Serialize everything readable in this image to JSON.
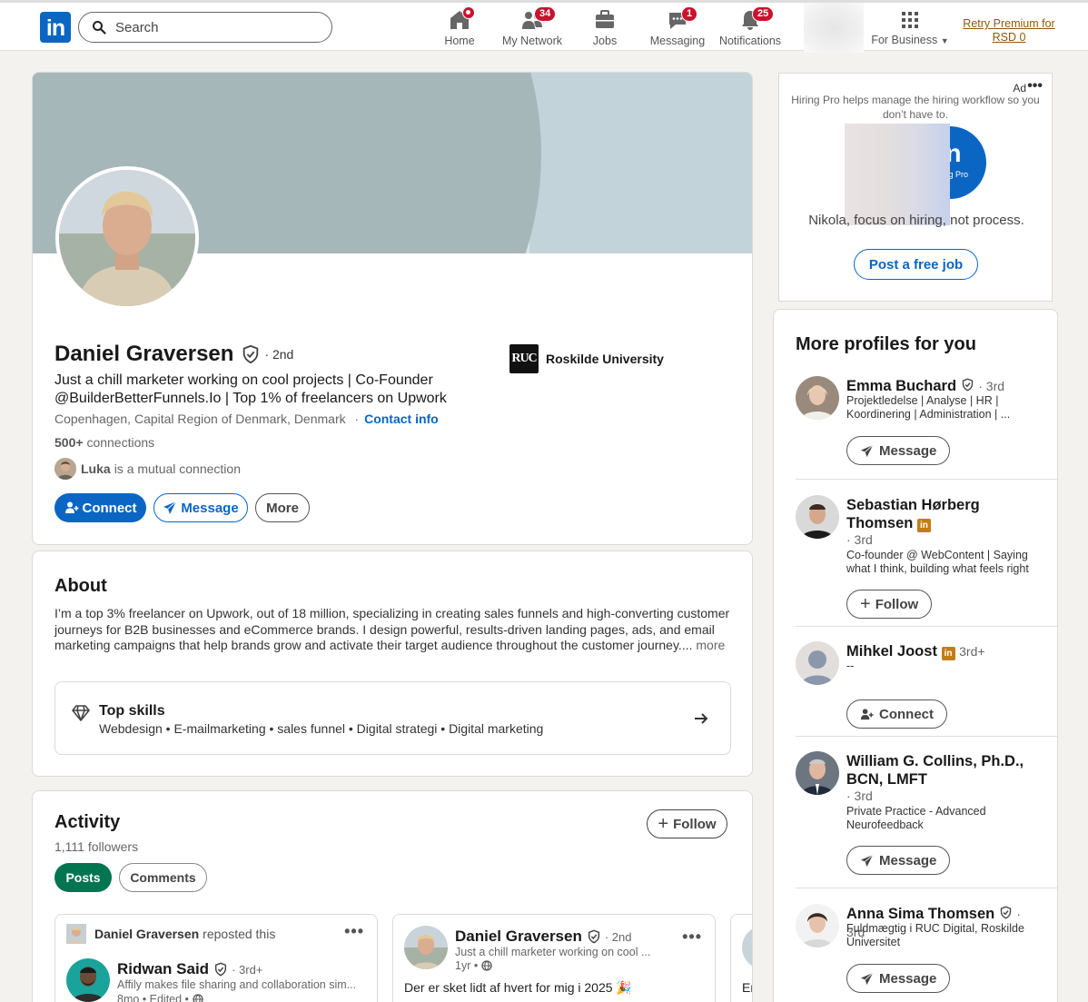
{
  "nav": {
    "logo": "in",
    "search_placeholder": "Search",
    "items": [
      {
        "label": "Home",
        "badge": ""
      },
      {
        "label": "My Network",
        "badge": "34"
      },
      {
        "label": "Jobs",
        "badge": ""
      },
      {
        "label": "Messaging",
        "badge": "1"
      },
      {
        "label": "Notifications",
        "badge": "25"
      }
    ],
    "for_business": "For Business",
    "premium": "Retry Premium for RSD 0"
  },
  "profile": {
    "name": "Daniel Graversen",
    "degree": "· 2nd",
    "headline": "Just a chill marketer working on cool projects | Co-Founder @BuilderBetterFunnels.Io |  Top 1% of freelancers on Upwork",
    "location": "Copenhagen, Capital Region of Denmark, Denmark",
    "contact_sep": "·",
    "contact_info": "Contact info",
    "connections_count": "500+",
    "connections_label": "connections",
    "mutual_name": "Luka",
    "mutual_text": "is a mutual connection",
    "connect_label": "Connect",
    "message_label": "Message",
    "more_label": "More",
    "education_logo": "RUC",
    "education": "Roskilde University"
  },
  "about": {
    "title": "About",
    "text": "I’m a top 3% freelancer on Upwork, out of 18 million, specializing in creating sales funnels and high-converting customer journeys for B2B businesses and eCommerce brands. I design powerful, results-driven landing pages, ads, and email marketing campaigns that help brands grow and activate their target audience throughout the customer journey....",
    "more": "more",
    "skills_title": "Top skills",
    "skills": "Webdesign • E-mailmarketing • sales funnel • Digital strategi • Digital marketing"
  },
  "activity": {
    "title": "Activity",
    "followers": "1,111 followers",
    "follow_label": "Follow",
    "tabs": [
      "Posts",
      "Comments"
    ],
    "posts": [
      {
        "repost_name": "Daniel Graversen",
        "repost_text": "reposted this",
        "author": "Ridwan Said",
        "degree": "· 3rd+",
        "subtitle": "Affily makes file sharing and collaboration sim...",
        "meta": "8mo • Edited •"
      },
      {
        "author": "Daniel Graversen",
        "degree": "· 2nd",
        "subtitle": "Just a chill marketer working on cool ...",
        "meta": "1yr •",
        "text": "Der er sket lidt af hvert for mig i 2025 🎉"
      }
    ],
    "partial_text": "Er"
  },
  "ad": {
    "label": "Ad",
    "text": "Hiring Pro helps manage the hiring workflow so you don’t have to.",
    "logo_text": "in",
    "logo_sub": "Hiring Pro",
    "tagline": "Nikola, focus on hiring, not process.",
    "cta": "Post a free job"
  },
  "more_profiles": {
    "title": "More profiles for you",
    "items": [
      {
        "name": "Emma Buchard",
        "degree": "· 3rd",
        "desc": "Projektledelse | Analyse | HR | Koordinering | Administration | ...",
        "action": "Message"
      },
      {
        "name": "Sebastian Hørberg Thomsen",
        "degree": "· 3rd",
        "desc": "Co-founder @ WebContent | Saying what I think, building what feels right",
        "action": "Follow"
      },
      {
        "name": "Mihkel Joost",
        "degree": "3rd+",
        "desc": "--",
        "action": "Connect"
      },
      {
        "name": "William G. Collins, Ph.D., BCN, LMFT",
        "degree": "· 3rd",
        "desc": "Private Practice -  Advanced Neurofeedback",
        "action": "Message"
      },
      {
        "name": "Anna Sima Thomsen",
        "degree": "· 3rd",
        "desc": "Fuldmægtig i RUC Digital, Roskilde Universitet",
        "action": "Message"
      }
    ]
  },
  "colors": {
    "brand_blue": "#0a66c2",
    "badge_red": "#cb112d",
    "posts_green": "#01754f",
    "premium_gold": "#915907"
  }
}
